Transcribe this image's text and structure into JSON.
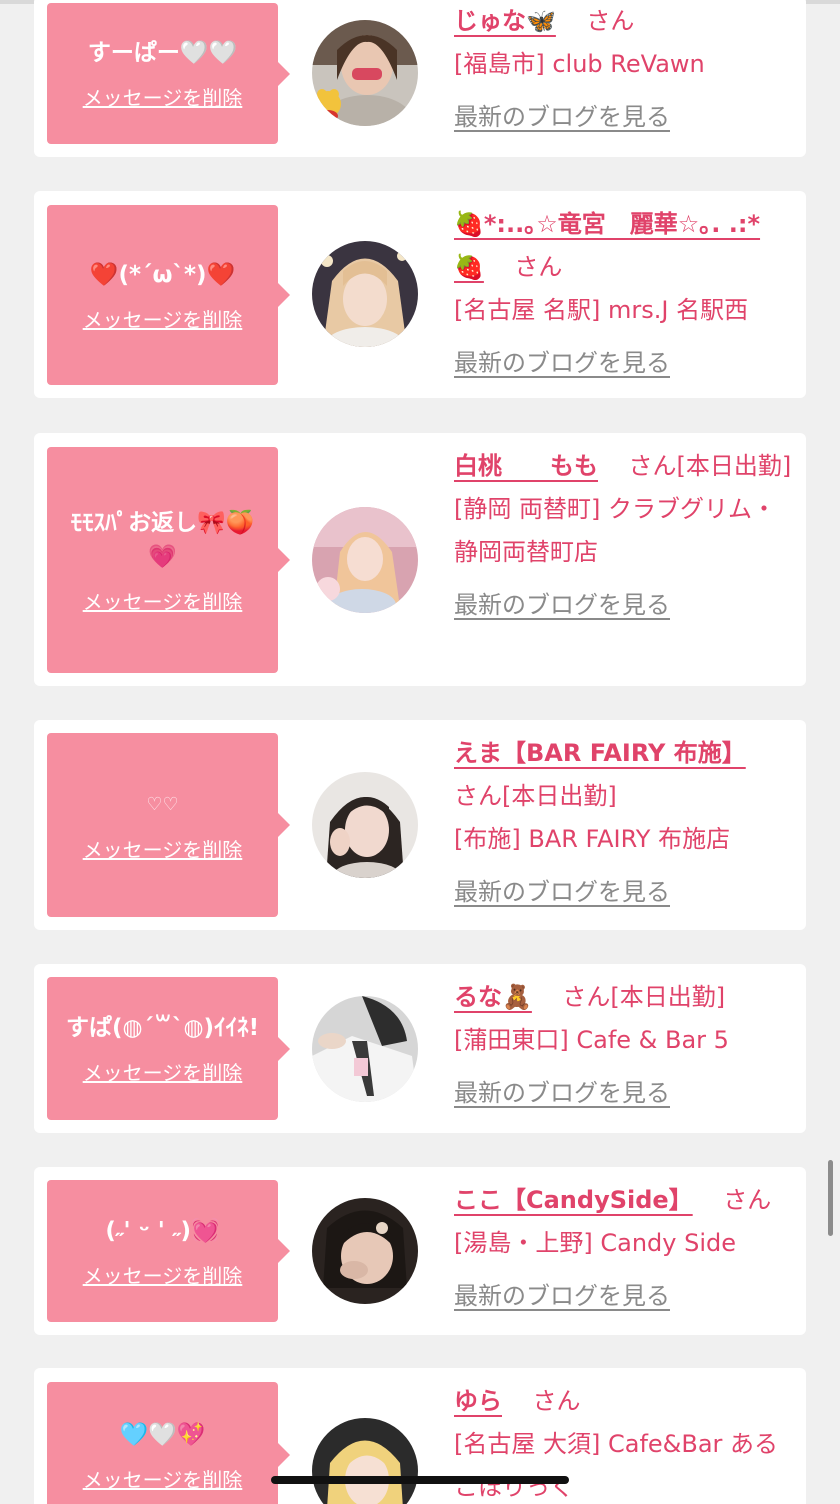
{
  "items": [
    {
      "message": "すーぱー🤍🤍",
      "delete_label": "メッセージを削除",
      "name": "じゅな🦋",
      "honorific": "さん",
      "status": "",
      "area_shop": "[福島市] club ReVawn",
      "blog_label": "最新のブログを見る"
    },
    {
      "message": "❤️(*´ω`*)❤️",
      "delete_label": "メッセージを削除",
      "name": "🍓*:..｡☆竜宮　麗華☆｡. .:*🍓",
      "honorific": "さん",
      "status": "",
      "area_shop": "[名古屋 名駅] mrs.J 名駅西",
      "blog_label": "最新のブログを見る"
    },
    {
      "message": "ﾓﾓｽﾊﾟお返し🎀🍑💗",
      "delete_label": "メッセージを削除",
      "name": "白桃　　もも",
      "honorific": "さん",
      "status": "[本日出勤]",
      "area_shop": "[静岡 両替町] クラブグリム・静岡両替町店",
      "blog_label": "最新のブログを見る"
    },
    {
      "message": "♡♡",
      "delete_label": "メッセージを削除",
      "name": "えま【BAR FAIRY 布施】",
      "honorific": "さん",
      "status": "[本日出勤]",
      "area_shop": "[布施] BAR FAIRY 布施店",
      "blog_label": "最新のブログを見る"
    },
    {
      "message": "すぱ(◍´꒳`◍)ｲｲﾈ!",
      "delete_label": "メッセージを削除",
      "name": "るな🧸",
      "honorific": "さん",
      "status": "[本日出勤]",
      "area_shop": "[蒲田東口] Cafe & Bar 5",
      "blog_label": "最新のブログを見る"
    },
    {
      "message": "(˶' ᵕ ' ˶)💓",
      "delete_label": "メッセージを削除",
      "name": "ここ【CandySide】",
      "honorific": "さん",
      "status": "",
      "area_shop": "[湯島・上野] Candy Side",
      "blog_label": "最新のブログを見る"
    },
    {
      "message": "🩵🤍💖",
      "delete_label": "メッセージを削除",
      "name": "ゆら",
      "honorific": "さん",
      "status": "",
      "area_shop": "[名古屋 大須] Cafe&Bar あるこほりっく",
      "blog_label": ""
    }
  ],
  "colors": {
    "bubble": "#f68ea0",
    "accent_text": "#e0436a",
    "muted_link": "#8a8a8a"
  }
}
